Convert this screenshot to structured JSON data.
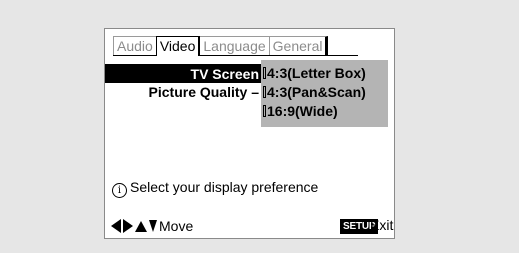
{
  "tabs": [
    "Audio",
    "Video",
    "Language",
    "General"
  ],
  "settings": [
    {
      "label": "TV Screen",
      "selected": true
    },
    {
      "label": "Picture Quality –",
      "selected": false
    }
  ],
  "options": [
    "4:3(Letter Box)",
    "4:3(Pan&Scan)",
    "16:9(Wide)"
  ],
  "info": {
    "icon": "info-icon",
    "text": "Select your display preference"
  },
  "footer": {
    "move_label": "Move",
    "setup_label": "SETUP",
    "exit_label": "Exit"
  },
  "colors": {
    "background": "#e6e6e6",
    "panel": "#ffffff",
    "highlight": "#000000",
    "options_shade": "#b4b4b4"
  }
}
